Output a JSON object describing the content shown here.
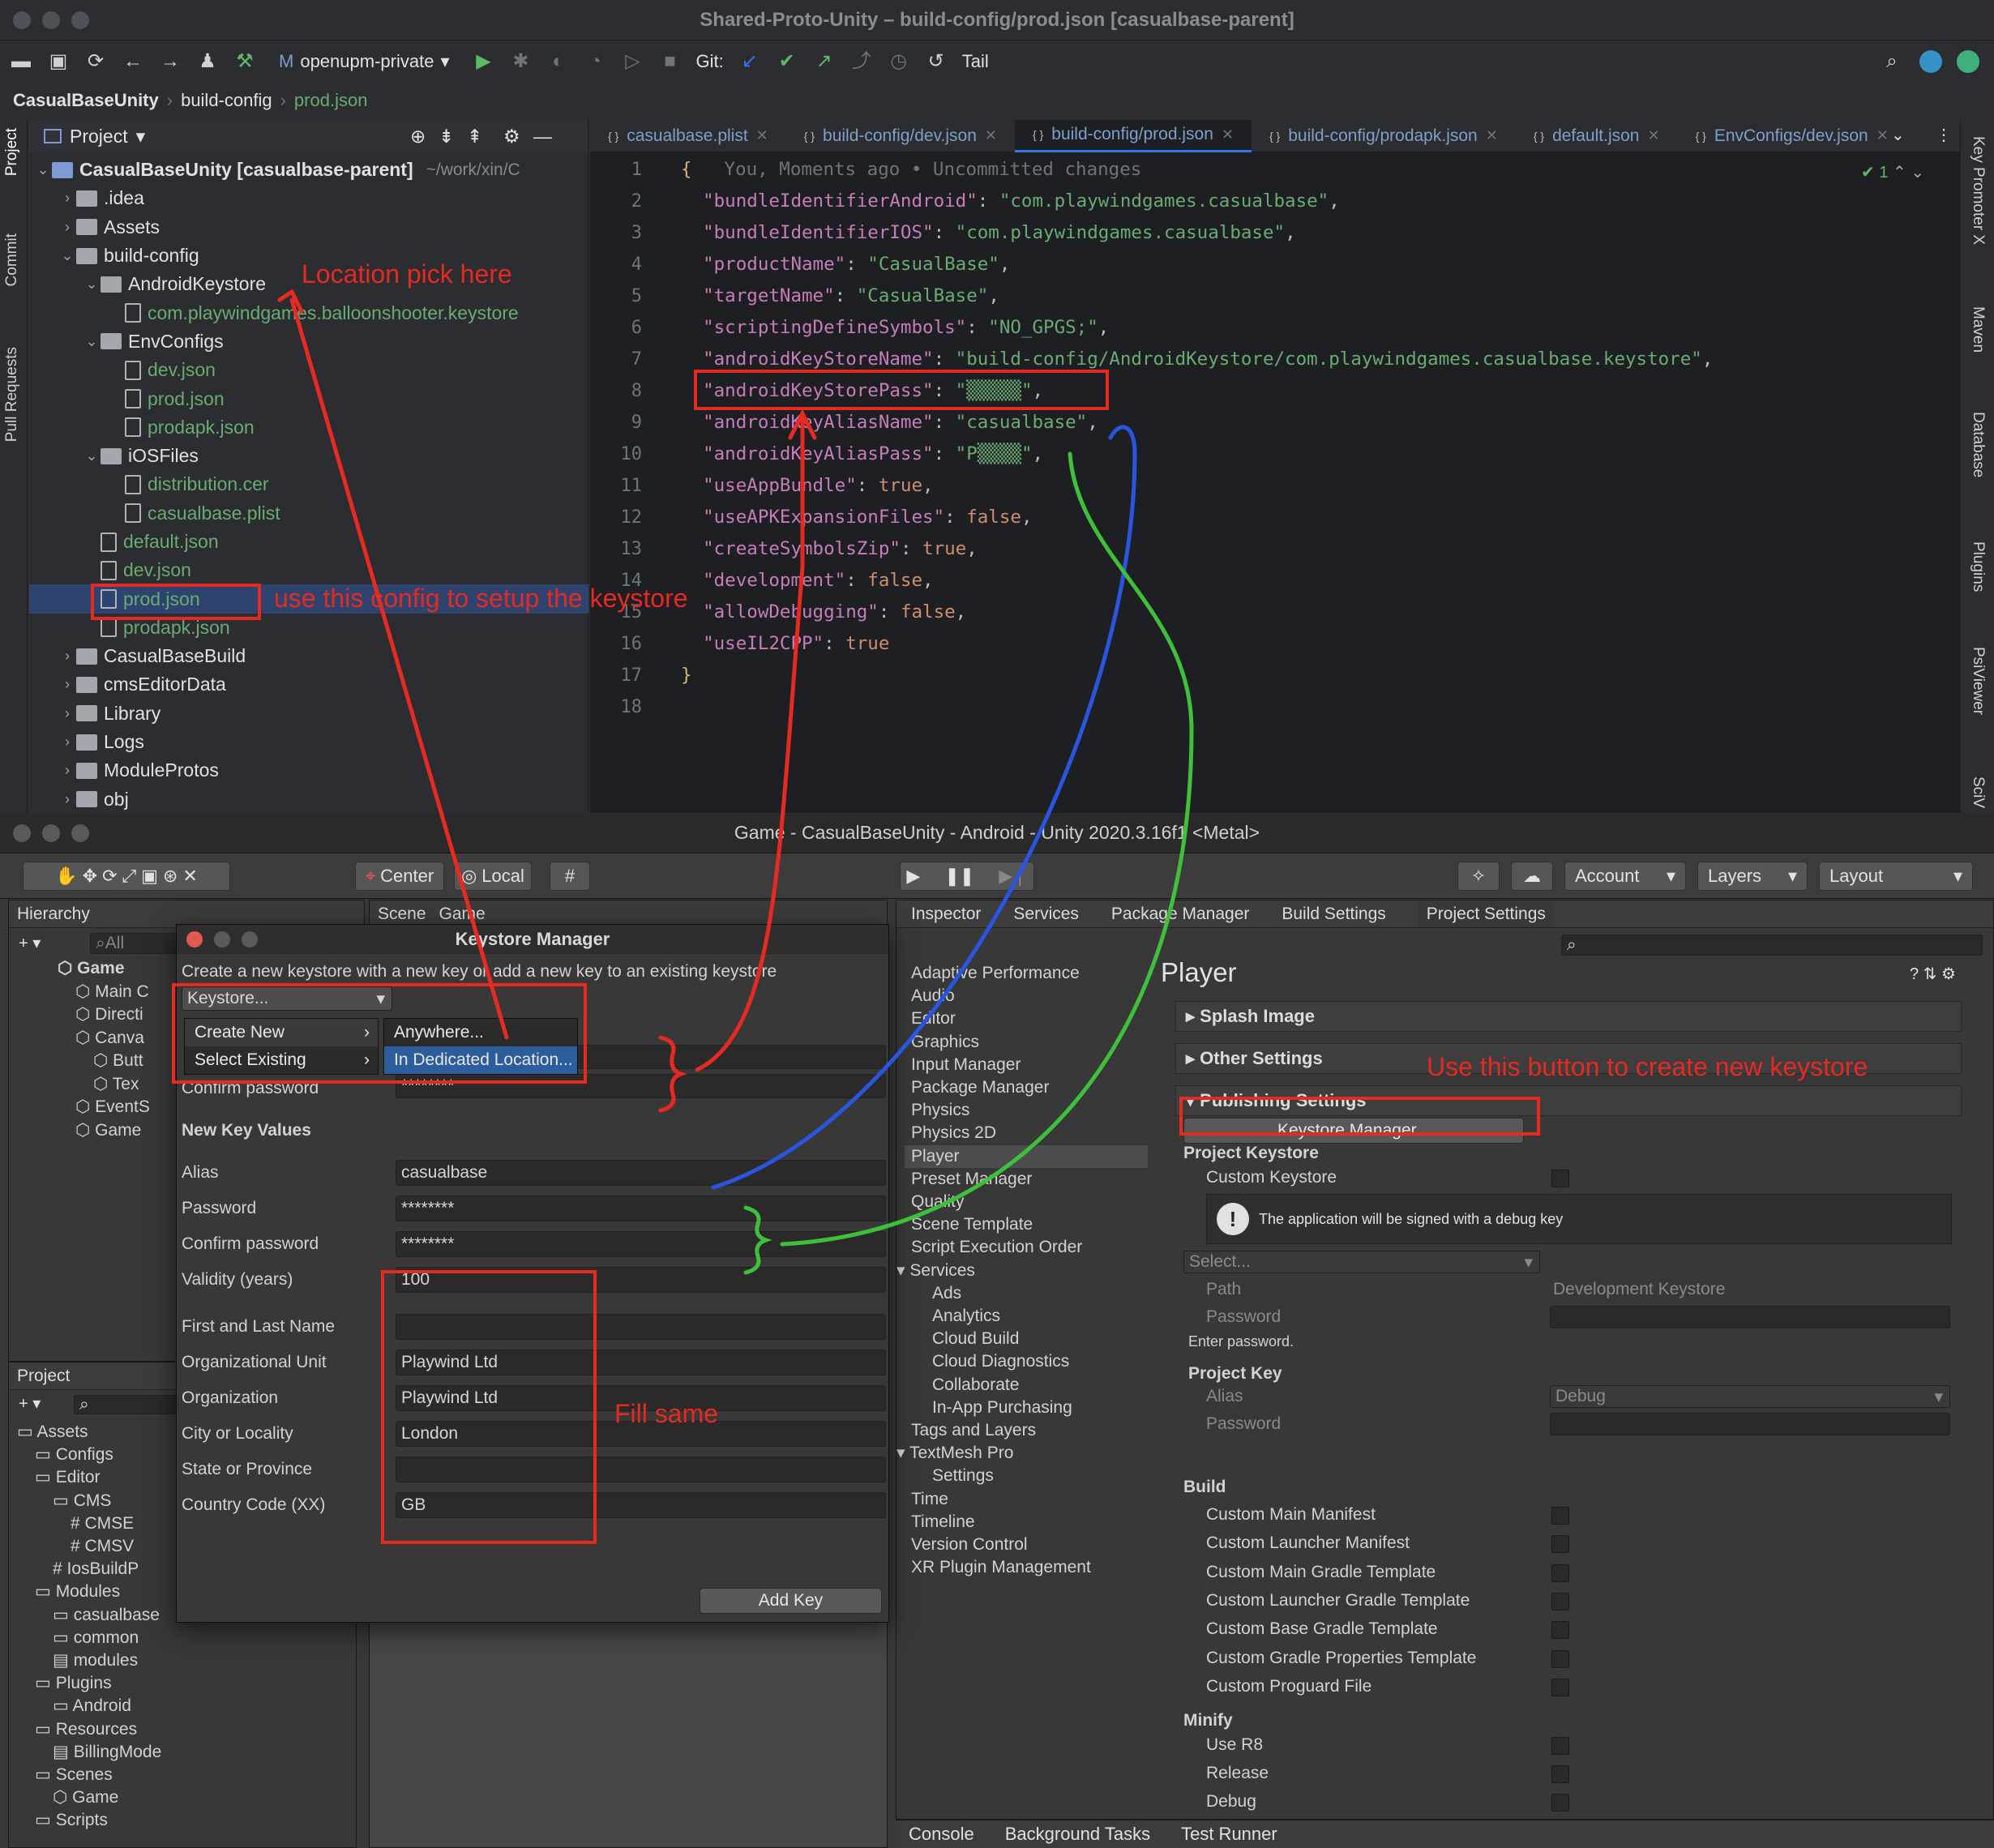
{
  "ide": {
    "title": "Shared-Proto-Unity – build-config/prod.json [casualbase-parent]",
    "toolbar": {
      "branch": "openupm-private",
      "git_label": "Git:",
      "tail": "Tail"
    },
    "breadcrumb": [
      "CasualBaseUnity",
      "build-config",
      "prod.json"
    ],
    "left_tools": [
      "Project",
      "Commit",
      "Pull Requests"
    ],
    "right_tools": [
      "Key Promoter X",
      "Maven",
      "Database",
      "Plugins",
      "PsiViewer",
      "SciV"
    ],
    "project": {
      "header": "Project",
      "tree": [
        {
          "label": "CasualBaseUnity [casualbase-parent]",
          "extra": "~/work/xin/C",
          "depth": 0,
          "kind": "folder",
          "open": true
        },
        {
          "label": ".idea",
          "depth": 1,
          "kind": "folder"
        },
        {
          "label": "Assets",
          "depth": 1,
          "kind": "folder"
        },
        {
          "label": "build-config",
          "depth": 1,
          "kind": "folder",
          "open": true
        },
        {
          "label": "AndroidKeystore",
          "depth": 2,
          "kind": "folder",
          "open": true
        },
        {
          "label": "com.playwindgames.balloonshooter.keystore",
          "depth": 3,
          "kind": "file",
          "green": true
        },
        {
          "label": "EnvConfigs",
          "depth": 2,
          "kind": "folder",
          "open": true
        },
        {
          "label": "dev.json",
          "depth": 3,
          "kind": "file",
          "green": true
        },
        {
          "label": "prod.json",
          "depth": 3,
          "kind": "file",
          "green": true
        },
        {
          "label": "prodapk.json",
          "depth": 3,
          "kind": "file",
          "green": true
        },
        {
          "label": "iOSFiles",
          "depth": 2,
          "kind": "folder",
          "open": true
        },
        {
          "label": "distribution.cer",
          "depth": 3,
          "kind": "file",
          "green": true
        },
        {
          "label": "casualbase.plist",
          "depth": 3,
          "kind": "file",
          "green": true
        },
        {
          "label": "default.json",
          "depth": 2,
          "kind": "file",
          "green": true
        },
        {
          "label": "dev.json",
          "depth": 2,
          "kind": "file",
          "green": true
        },
        {
          "label": "prod.json",
          "depth": 2,
          "kind": "file",
          "green": true,
          "selected": true
        },
        {
          "label": "prodapk.json",
          "depth": 2,
          "kind": "file",
          "green": true
        },
        {
          "label": "CasualBaseBuild",
          "depth": 1,
          "kind": "folder"
        },
        {
          "label": "cmsEditorData",
          "depth": 1,
          "kind": "folder"
        },
        {
          "label": "Library",
          "depth": 1,
          "kind": "folder"
        },
        {
          "label": "Logs",
          "depth": 1,
          "kind": "folder"
        },
        {
          "label": "ModuleProtos",
          "depth": 1,
          "kind": "folder"
        },
        {
          "label": "obj",
          "depth": 1,
          "kind": "folder"
        }
      ]
    },
    "tabs": [
      {
        "label": "casualbase.plist",
        "active": false
      },
      {
        "label": "build-config/dev.json",
        "active": false
      },
      {
        "label": "build-config/prod.json",
        "active": true
      },
      {
        "label": "build-config/prodapk.json",
        "active": false
      },
      {
        "label": "default.json",
        "active": false
      },
      {
        "label": "EnvConfigs/dev.json",
        "active": false
      }
    ],
    "inline_hint": "You, Moments ago • Uncommitted changes",
    "check_count": "1",
    "code": [
      {
        "k": "",
        "v": "{"
      },
      {
        "k": "bundleIdentifierAndroid",
        "v": "\"com.playwindgames.casualbase\""
      },
      {
        "k": "bundleIdentifierIOS",
        "v": "\"com.playwindgames.casualbase\""
      },
      {
        "k": "productName",
        "v": "\"CasualBase\""
      },
      {
        "k": "targetName",
        "v": "\"CasualBase\""
      },
      {
        "k": "scriptingDefineSymbols",
        "v": "\"NO_GPGS;\""
      },
      {
        "k": "androidKeyStoreName",
        "v": "\"build-config/AndroidKeystore/com.playwindgames.casualbase.keystore\""
      },
      {
        "k": "androidKeyStorePass",
        "v": "\"▒▒▒▒▒\""
      },
      {
        "k": "androidKeyAliasName",
        "v": "\"casualbase\""
      },
      {
        "k": "androidKeyAliasPass",
        "v": "\"P▒▒▒▒\""
      },
      {
        "k": "useAppBundle",
        "v": "true"
      },
      {
        "k": "useAPKExpansionFiles",
        "v": "false"
      },
      {
        "k": "createSymbolsZip",
        "v": "true"
      },
      {
        "k": "development",
        "v": "false"
      },
      {
        "k": "allowDebugging",
        "v": "false"
      },
      {
        "k": "useIL2CPP",
        "v": "true"
      },
      {
        "k": "",
        "v": "}"
      },
      {
        "k": "",
        "v": ""
      }
    ]
  },
  "annotations": {
    "location": "Location pick here",
    "use_config": "use this config to setup the keystore",
    "use_button": "Use this button to create new keystore",
    "fill_same": "Fill same"
  },
  "unity": {
    "title": "Game - CasualBaseUnity - Android - Unity 2020.3.16f1 <Metal>",
    "toolbar": {
      "center": "Center",
      "local": "Local",
      "account": "Account",
      "layers": "Layers",
      "layout": "Layout"
    },
    "hierarchy": {
      "tab": "Hierarchy",
      "search": "All",
      "items": [
        "Game",
        "Main C",
        "Directi",
        "Canva",
        "Butt",
        "Tex",
        "EventS",
        "Game"
      ]
    },
    "scene_tabs": [
      "Scene",
      "Game"
    ],
    "project": {
      "tab": "Project",
      "items": [
        "Assets",
        "Configs",
        "Editor",
        "CMS",
        "CMSE",
        "CMSV",
        "IosBuildP",
        "Modules",
        "casualbase",
        "common",
        "modules",
        "Plugins",
        "Android",
        "Resources",
        "BillingMode",
        "Scenes",
        "Game",
        "Scripts"
      ]
    },
    "keystore": {
      "title": "Keystore Manager",
      "subtitle": "Create a new keystore with a new key or add a new key to an existing keystore",
      "dropdown": "Keystore...",
      "menu": [
        "Create New",
        "Select Existing"
      ],
      "submenu": [
        "Anywhere...",
        "In Dedicated Location..."
      ],
      "confirm_label": "Confirm password",
      "confirm_value": "********",
      "section": "New Key Values",
      "fields": [
        {
          "label": "Alias",
          "value": "casualbase"
        },
        {
          "label": "Password",
          "value": "********"
        },
        {
          "label": "Confirm password",
          "value": "********"
        },
        {
          "label": "Validity (years)",
          "value": "100"
        },
        {
          "label": "First and Last Name",
          "value": ""
        },
        {
          "label": "Organizational Unit",
          "value": "Playwind Ltd"
        },
        {
          "label": "Organization",
          "value": "Playwind Ltd"
        },
        {
          "label": "City or Locality",
          "value": "London"
        },
        {
          "label": "State or Province",
          "value": ""
        },
        {
          "label": "Country Code (XX)",
          "value": "GB"
        }
      ],
      "add_key": "Add Key"
    },
    "inspector_tabs": [
      "Inspector",
      "Services",
      "Package Manager",
      "Build Settings",
      "Project Settings"
    ],
    "settings_list": [
      {
        "label": "Adaptive Performance",
        "depth": 0
      },
      {
        "label": "Audio",
        "depth": 0
      },
      {
        "label": "Editor",
        "depth": 0
      },
      {
        "label": "Graphics",
        "depth": 0
      },
      {
        "label": "Input Manager",
        "depth": 0
      },
      {
        "label": "Package Manager",
        "depth": 0
      },
      {
        "label": "Physics",
        "depth": 0
      },
      {
        "label": "Physics 2D",
        "depth": 0
      },
      {
        "label": "Player",
        "depth": 0,
        "selected": true
      },
      {
        "label": "Preset Manager",
        "depth": 0
      },
      {
        "label": "Quality",
        "depth": 0
      },
      {
        "label": "Scene Template",
        "depth": 0
      },
      {
        "label": "Script Execution Order",
        "depth": 0
      },
      {
        "label": "Services",
        "depth": 0,
        "open": true
      },
      {
        "label": "Ads",
        "depth": 1
      },
      {
        "label": "Analytics",
        "depth": 1
      },
      {
        "label": "Cloud Build",
        "depth": 1
      },
      {
        "label": "Cloud Diagnostics",
        "depth": 1
      },
      {
        "label": "Collaborate",
        "depth": 1
      },
      {
        "label": "In-App Purchasing",
        "depth": 1
      },
      {
        "label": "Tags and Layers",
        "depth": 0
      },
      {
        "label": "TextMesh Pro",
        "depth": 0,
        "open": true
      },
      {
        "label": "Settings",
        "depth": 1
      },
      {
        "label": "Time",
        "depth": 0
      },
      {
        "label": "Timeline",
        "depth": 0
      },
      {
        "label": "Version Control",
        "depth": 0
      },
      {
        "label": "XR Plugin Management",
        "depth": 0
      }
    ],
    "player": {
      "title": "Player",
      "sections": [
        "Splash Image",
        "Other Settings",
        "Publishing Settings"
      ],
      "keystore_button": "Keystore Manager...",
      "project_keystore": "Project Keystore",
      "custom_keystore": "Custom Keystore",
      "warning": "The application will be signed with a debug key",
      "select": "Select...",
      "path_label": "Path",
      "path_value": "Development Keystore",
      "password_label": "Password",
      "enter_password": "Enter password.",
      "project_key": "Project Key",
      "alias_label": "Alias",
      "alias_value": "Debug",
      "key_password_label": "Password",
      "build": "Build",
      "build_items": [
        "Custom Main Manifest",
        "Custom Launcher Manifest",
        "Custom Main Gradle Template",
        "Custom Launcher Gradle Template",
        "Custom Base Gradle Template",
        "Custom Gradle Properties Template",
        "Custom Proguard File"
      ],
      "minify": "Minify",
      "minify_items": [
        "Use R8",
        "Release",
        "Debug"
      ]
    },
    "bottom_tabs": [
      "Console",
      "Background Tasks",
      "Test Runner"
    ]
  }
}
